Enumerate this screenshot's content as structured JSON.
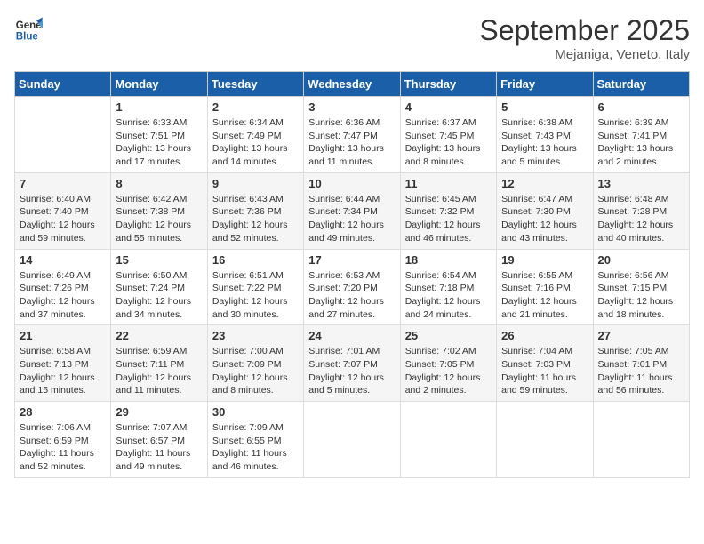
{
  "header": {
    "logo_line1": "General",
    "logo_line2": "Blue",
    "month": "September 2025",
    "location": "Mejaniga, Veneto, Italy"
  },
  "days_of_week": [
    "Sunday",
    "Monday",
    "Tuesday",
    "Wednesday",
    "Thursday",
    "Friday",
    "Saturday"
  ],
  "weeks": [
    [
      {
        "day": "",
        "sunrise": "",
        "sunset": "",
        "daylight": ""
      },
      {
        "day": "1",
        "sunrise": "Sunrise: 6:33 AM",
        "sunset": "Sunset: 7:51 PM",
        "daylight": "Daylight: 13 hours and 17 minutes."
      },
      {
        "day": "2",
        "sunrise": "Sunrise: 6:34 AM",
        "sunset": "Sunset: 7:49 PM",
        "daylight": "Daylight: 13 hours and 14 minutes."
      },
      {
        "day": "3",
        "sunrise": "Sunrise: 6:36 AM",
        "sunset": "Sunset: 7:47 PM",
        "daylight": "Daylight: 13 hours and 11 minutes."
      },
      {
        "day": "4",
        "sunrise": "Sunrise: 6:37 AM",
        "sunset": "Sunset: 7:45 PM",
        "daylight": "Daylight: 13 hours and 8 minutes."
      },
      {
        "day": "5",
        "sunrise": "Sunrise: 6:38 AM",
        "sunset": "Sunset: 7:43 PM",
        "daylight": "Daylight: 13 hours and 5 minutes."
      },
      {
        "day": "6",
        "sunrise": "Sunrise: 6:39 AM",
        "sunset": "Sunset: 7:41 PM",
        "daylight": "Daylight: 13 hours and 2 minutes."
      }
    ],
    [
      {
        "day": "7",
        "sunrise": "Sunrise: 6:40 AM",
        "sunset": "Sunset: 7:40 PM",
        "daylight": "Daylight: 12 hours and 59 minutes."
      },
      {
        "day": "8",
        "sunrise": "Sunrise: 6:42 AM",
        "sunset": "Sunset: 7:38 PM",
        "daylight": "Daylight: 12 hours and 55 minutes."
      },
      {
        "day": "9",
        "sunrise": "Sunrise: 6:43 AM",
        "sunset": "Sunset: 7:36 PM",
        "daylight": "Daylight: 12 hours and 52 minutes."
      },
      {
        "day": "10",
        "sunrise": "Sunrise: 6:44 AM",
        "sunset": "Sunset: 7:34 PM",
        "daylight": "Daylight: 12 hours and 49 minutes."
      },
      {
        "day": "11",
        "sunrise": "Sunrise: 6:45 AM",
        "sunset": "Sunset: 7:32 PM",
        "daylight": "Daylight: 12 hours and 46 minutes."
      },
      {
        "day": "12",
        "sunrise": "Sunrise: 6:47 AM",
        "sunset": "Sunset: 7:30 PM",
        "daylight": "Daylight: 12 hours and 43 minutes."
      },
      {
        "day": "13",
        "sunrise": "Sunrise: 6:48 AM",
        "sunset": "Sunset: 7:28 PM",
        "daylight": "Daylight: 12 hours and 40 minutes."
      }
    ],
    [
      {
        "day": "14",
        "sunrise": "Sunrise: 6:49 AM",
        "sunset": "Sunset: 7:26 PM",
        "daylight": "Daylight: 12 hours and 37 minutes."
      },
      {
        "day": "15",
        "sunrise": "Sunrise: 6:50 AM",
        "sunset": "Sunset: 7:24 PM",
        "daylight": "Daylight: 12 hours and 34 minutes."
      },
      {
        "day": "16",
        "sunrise": "Sunrise: 6:51 AM",
        "sunset": "Sunset: 7:22 PM",
        "daylight": "Daylight: 12 hours and 30 minutes."
      },
      {
        "day": "17",
        "sunrise": "Sunrise: 6:53 AM",
        "sunset": "Sunset: 7:20 PM",
        "daylight": "Daylight: 12 hours and 27 minutes."
      },
      {
        "day": "18",
        "sunrise": "Sunrise: 6:54 AM",
        "sunset": "Sunset: 7:18 PM",
        "daylight": "Daylight: 12 hours and 24 minutes."
      },
      {
        "day": "19",
        "sunrise": "Sunrise: 6:55 AM",
        "sunset": "Sunset: 7:16 PM",
        "daylight": "Daylight: 12 hours and 21 minutes."
      },
      {
        "day": "20",
        "sunrise": "Sunrise: 6:56 AM",
        "sunset": "Sunset: 7:15 PM",
        "daylight": "Daylight: 12 hours and 18 minutes."
      }
    ],
    [
      {
        "day": "21",
        "sunrise": "Sunrise: 6:58 AM",
        "sunset": "Sunset: 7:13 PM",
        "daylight": "Daylight: 12 hours and 15 minutes."
      },
      {
        "day": "22",
        "sunrise": "Sunrise: 6:59 AM",
        "sunset": "Sunset: 7:11 PM",
        "daylight": "Daylight: 12 hours and 11 minutes."
      },
      {
        "day": "23",
        "sunrise": "Sunrise: 7:00 AM",
        "sunset": "Sunset: 7:09 PM",
        "daylight": "Daylight: 12 hours and 8 minutes."
      },
      {
        "day": "24",
        "sunrise": "Sunrise: 7:01 AM",
        "sunset": "Sunset: 7:07 PM",
        "daylight": "Daylight: 12 hours and 5 minutes."
      },
      {
        "day": "25",
        "sunrise": "Sunrise: 7:02 AM",
        "sunset": "Sunset: 7:05 PM",
        "daylight": "Daylight: 12 hours and 2 minutes."
      },
      {
        "day": "26",
        "sunrise": "Sunrise: 7:04 AM",
        "sunset": "Sunset: 7:03 PM",
        "daylight": "Daylight: 11 hours and 59 minutes."
      },
      {
        "day": "27",
        "sunrise": "Sunrise: 7:05 AM",
        "sunset": "Sunset: 7:01 PM",
        "daylight": "Daylight: 11 hours and 56 minutes."
      }
    ],
    [
      {
        "day": "28",
        "sunrise": "Sunrise: 7:06 AM",
        "sunset": "Sunset: 6:59 PM",
        "daylight": "Daylight: 11 hours and 52 minutes."
      },
      {
        "day": "29",
        "sunrise": "Sunrise: 7:07 AM",
        "sunset": "Sunset: 6:57 PM",
        "daylight": "Daylight: 11 hours and 49 minutes."
      },
      {
        "day": "30",
        "sunrise": "Sunrise: 7:09 AM",
        "sunset": "Sunset: 6:55 PM",
        "daylight": "Daylight: 11 hours and 46 minutes."
      },
      {
        "day": "",
        "sunrise": "",
        "sunset": "",
        "daylight": ""
      },
      {
        "day": "",
        "sunrise": "",
        "sunset": "",
        "daylight": ""
      },
      {
        "day": "",
        "sunrise": "",
        "sunset": "",
        "daylight": ""
      },
      {
        "day": "",
        "sunrise": "",
        "sunset": "",
        "daylight": ""
      }
    ]
  ]
}
